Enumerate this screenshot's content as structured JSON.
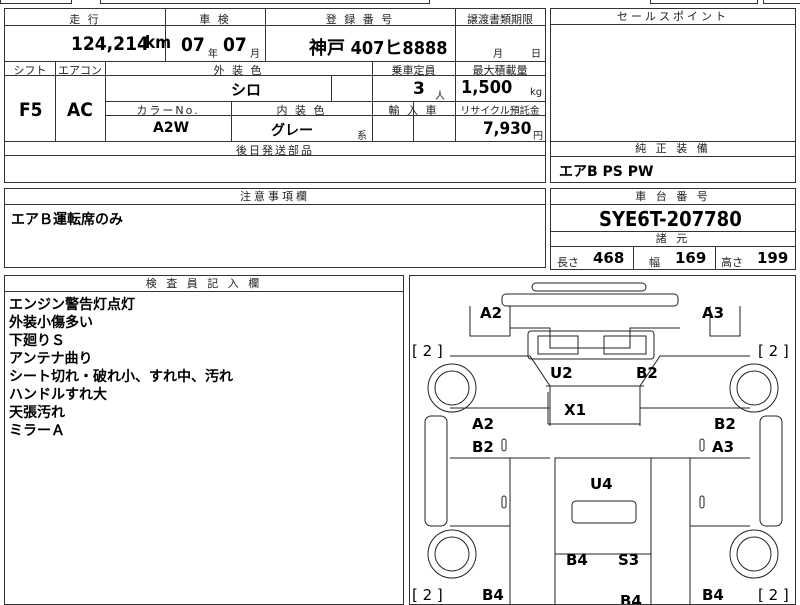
{
  "mileage": {
    "label": "走 行",
    "value": "124,214",
    "unit": "km"
  },
  "inspection": {
    "label": "車 検",
    "year": "07",
    "year_unit": "年",
    "month": "07",
    "month_unit": "月"
  },
  "registration": {
    "label": "登 録 番 号",
    "value": "神戸 407ヒ8888"
  },
  "transfer": {
    "label": "譲渡書類期限",
    "month_unit": "月",
    "day_unit": "日"
  },
  "sales_point": {
    "label": "セールスポイント"
  },
  "shift": {
    "label": "シフト",
    "value": "F5"
  },
  "aircon": {
    "label": "エアコン",
    "value": "AC"
  },
  "exterior_color": {
    "label": "外 装 色",
    "value": "シロ"
  },
  "capacity": {
    "label": "乗車定員",
    "value": "3",
    "unit": "人"
  },
  "max_load": {
    "label": "最大積載量",
    "value": "1,500",
    "unit": "kg"
  },
  "color_no": {
    "label": "カラーNo.",
    "value": "A2W"
  },
  "interior_color": {
    "label": "内 装 色",
    "value": "グレー",
    "suffix": "系"
  },
  "import": {
    "label": "輸 入 車"
  },
  "recycle": {
    "label": "リサイクル預託金",
    "value": "7,930",
    "unit": "円"
  },
  "later_parts": {
    "label": "後日発送部品"
  },
  "genuine_equipment": {
    "label": "純 正 装 備",
    "value": "エアB PS PW"
  },
  "caution": {
    "label": "注意事項欄",
    "value": "エアＢ運転席のみ"
  },
  "chassis": {
    "label": "車 台 番 号",
    "value": "SYE6T-207780"
  },
  "specs": {
    "label": "諸 元",
    "length_label": "長さ",
    "length": "468",
    "width_label": "幅",
    "width": "169",
    "height_label": "高さ",
    "height": "199"
  },
  "inspector": {
    "label": "検 査 員 記 入 欄",
    "notes": [
      "エンジン警告灯点灯",
      "外装小傷多い",
      "下廻りＳ",
      "アンテナ曲り",
      "シート切れ・破れ小、すれ中、汚れ",
      "ハンドルすれ大",
      "天張汚れ",
      "ミラーＡ"
    ]
  },
  "diagram": {
    "marks": {
      "a2_top": "A2",
      "a3_top": "A3",
      "u2": "U2",
      "b2_top": "B2",
      "x1": "X1",
      "a2_left": "A2",
      "b2_left": "B2",
      "b2_right": "B2",
      "a3_right": "A3",
      "u4": "U4",
      "b4_mid": "B4",
      "s3": "S3",
      "b4_bl": "B4",
      "b4_bm": "B4",
      "b4_br": "B4"
    },
    "brackets": {
      "tl": "[ 2 ]",
      "tr": "[ 2 ]",
      "bl": "[ 2 ]",
      "br": "[ 2 ]"
    }
  }
}
